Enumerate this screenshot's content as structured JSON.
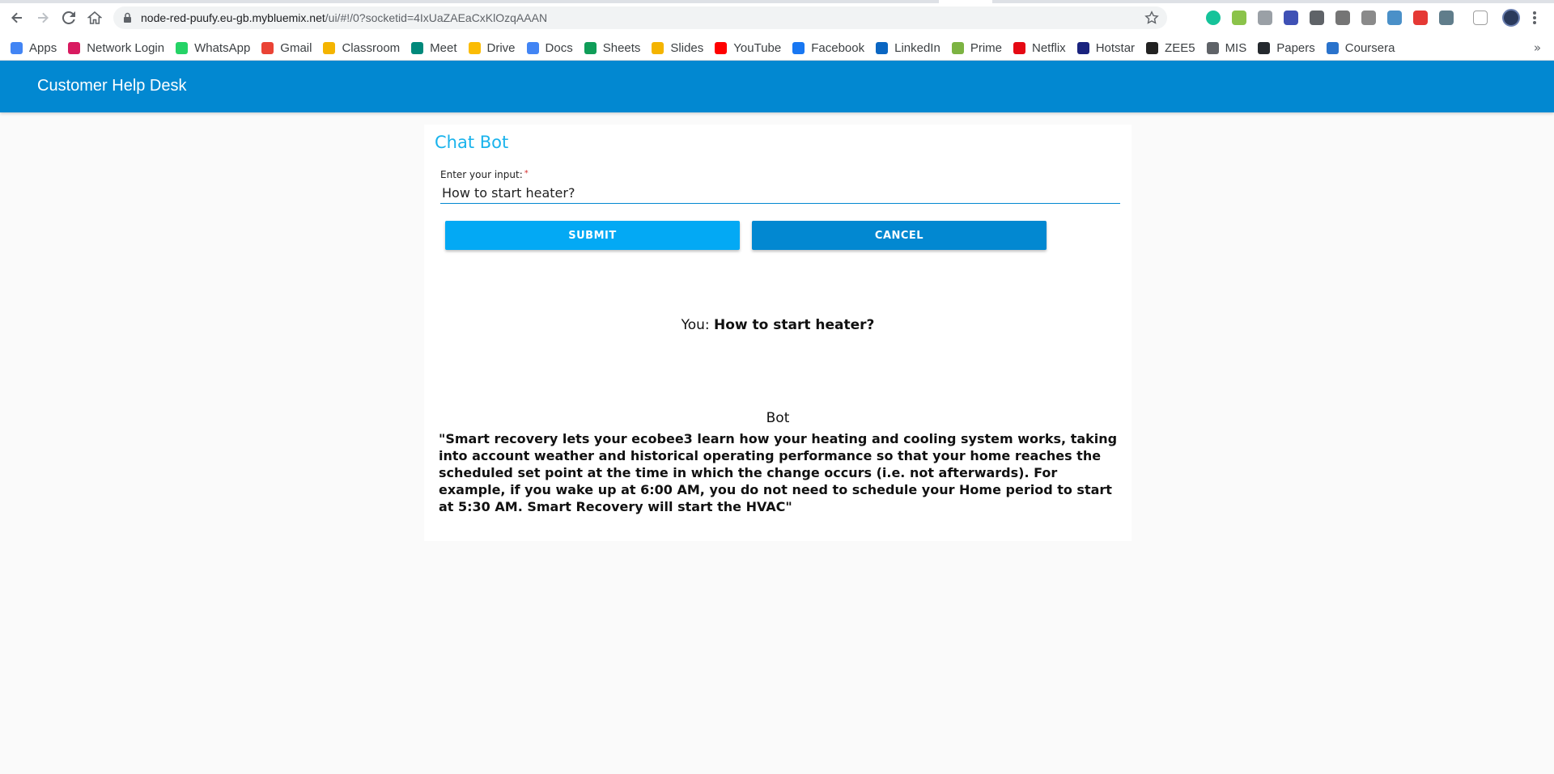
{
  "browser": {
    "url_host": "node-red-puufy.eu-gb.mybluemix.net",
    "url_path": "/ui/#!/0?socketid=4IxUaZAEaCxKlOzqAAAN",
    "bookmarks": [
      {
        "label": "Apps",
        "icon": "apps-grid-icon",
        "color": "#4285f4"
      },
      {
        "label": "Network Login",
        "icon": "umbrella-icon",
        "color": "#d81b60"
      },
      {
        "label": "WhatsApp",
        "icon": "whatsapp-icon",
        "color": "#25d366"
      },
      {
        "label": "Gmail",
        "icon": "gmail-icon",
        "color": "#ea4335"
      },
      {
        "label": "Classroom",
        "icon": "classroom-icon",
        "color": "#f4b400"
      },
      {
        "label": "Meet",
        "icon": "meet-icon",
        "color": "#00897b"
      },
      {
        "label": "Drive",
        "icon": "drive-icon",
        "color": "#fbbc04"
      },
      {
        "label": "Docs",
        "icon": "docs-icon",
        "color": "#4285f4"
      },
      {
        "label": "Sheets",
        "icon": "sheets-icon",
        "color": "#0f9d58"
      },
      {
        "label": "Slides",
        "icon": "slides-icon",
        "color": "#f4b400"
      },
      {
        "label": "YouTube",
        "icon": "youtube-icon",
        "color": "#ff0000"
      },
      {
        "label": "Facebook",
        "icon": "facebook-icon",
        "color": "#1877f2"
      },
      {
        "label": "LinkedIn",
        "icon": "linkedin-icon",
        "color": "#0a66c2"
      },
      {
        "label": "Prime",
        "icon": "prime-icon",
        "color": "#7cb342"
      },
      {
        "label": "Netflix",
        "icon": "netflix-icon",
        "color": "#e50914"
      },
      {
        "label": "Hotstar",
        "icon": "hotstar-icon",
        "color": "#1a237e"
      },
      {
        "label": "ZEE5",
        "icon": "zee5-icon",
        "color": "#222222"
      },
      {
        "label": "MIS",
        "icon": "globe-icon",
        "color": "#5f6368"
      },
      {
        "label": "Papers",
        "icon": "github-icon",
        "color": "#24292e"
      },
      {
        "label": "Coursera",
        "icon": "coursera-icon",
        "color": "#2a73cc"
      }
    ],
    "more_label": "»"
  },
  "app": {
    "title": "Customer Help Desk",
    "card_title": "Chat Bot",
    "input_label": "Enter your input:",
    "required_mark": "*",
    "input_value": "How to start heater?",
    "submit_label": "SUBMIT",
    "cancel_label": "CANCEL",
    "you_prefix": "You: ",
    "you_message": "How to start heater?",
    "bot_label": "Bot",
    "bot_message": "\"Smart recovery lets your ecobee3 learn how your heating and cooling system works, taking into account weather and historical operating performance so that your home reaches the scheduled set point at the time in which the change occurs (i.e. not afterwards). For example, if you wake up at 6:00 AM, you do not need to schedule your Home period to start at 5:30 AM. Smart Recovery will start the HVAC\""
  },
  "colors": {
    "header": "#0288d1",
    "card_title": "#1ab3ec",
    "submit": "#03a9f4",
    "cancel": "#0288d1"
  }
}
